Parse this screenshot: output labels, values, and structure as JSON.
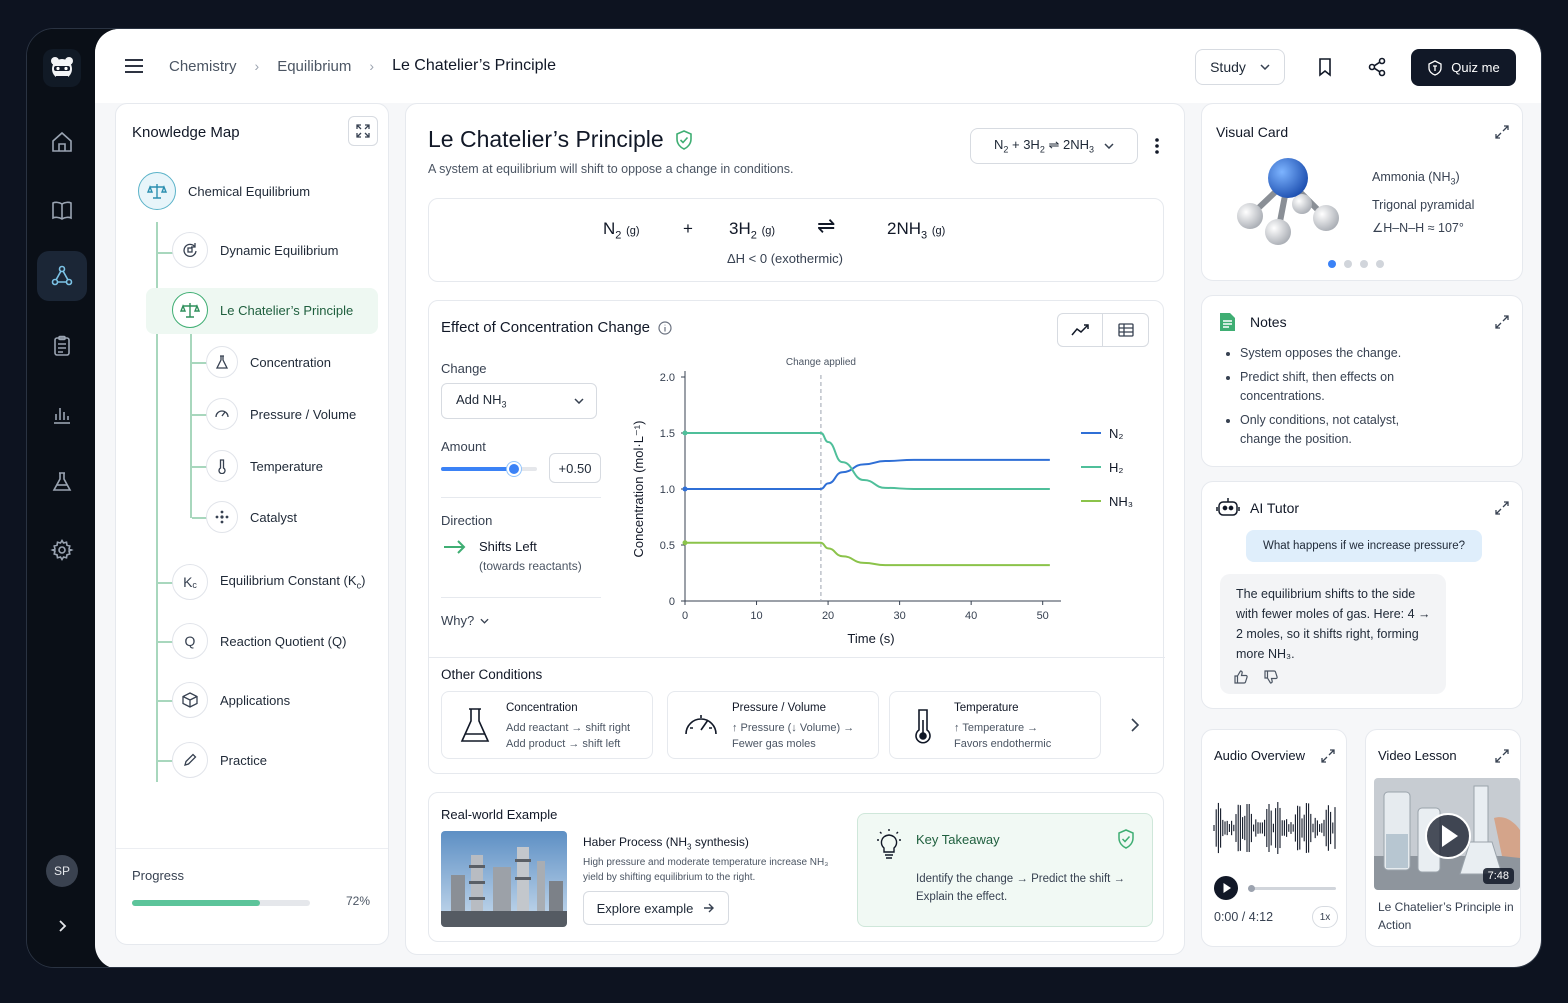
{
  "user": {
    "initials": "SP"
  },
  "breadcrumb": {
    "items": [
      "Chemistry",
      "Equilibrium"
    ],
    "current": "Le Chatelier’s Principle"
  },
  "header": {
    "study_label": "Study",
    "quiz_label": "Quiz me"
  },
  "knowledge_map": {
    "title": "Knowledge Map",
    "root": "Chemical Equilibrium",
    "nodes": {
      "dynamic": "Dynamic Equilibrium",
      "lechatelier": "Le Chatelier’s Principle",
      "concentration": "Concentration",
      "pressure": "Pressure / Volume",
      "temperature": "Temperature",
      "catalyst": "Catalyst",
      "kc": "Equilibrium Constant (K",
      "kc_sub": "c",
      "q": "Reaction Quotient (Q)",
      "applications": "Applications",
      "practice": "Practice"
    },
    "progress_label": "Progress",
    "progress_value": "72%",
    "progress_fraction": 0.72
  },
  "main": {
    "title": "Le Chatelier’s Principle",
    "subtitle": "A system at equilibrium will shift to oppose a change in conditions.",
    "equation_select": {
      "a": "N",
      "b": " + 3H",
      "c": "2NH"
    },
    "equation": {
      "n2": "N",
      "state_g": "(g)",
      "plus": "+",
      "h2": "3H",
      "arrow": "⇌",
      "nh3": "2NH",
      "dh": "ΔH < 0   (exothermic)"
    },
    "effect": {
      "title": "Effect of Concentration Change",
      "change_label": "Change",
      "change_value_prefix": "Add NH",
      "change_value_sub": "3",
      "amount_label": "Amount",
      "amount_value": "+0.50",
      "amount_fraction": 0.76,
      "direction_label": "Direction",
      "direction_value": "Shifts Left",
      "direction_sub": "(towards reactants)",
      "why_label": "Why?"
    },
    "other_conditions": {
      "title": "Other Conditions",
      "cards": [
        {
          "title": "Concentration",
          "l1": "Add reactant  →  shift right",
          "l2": "Add product  →  shift left"
        },
        {
          "title": "Pressure / Volume",
          "l1": "↑ Pressure (↓ Volume)  →",
          "l2": "Fewer gas moles"
        },
        {
          "title": "Temperature",
          "l1": "↑ Temperature  →",
          "l2": "Favors endothermic"
        }
      ]
    },
    "real_world": {
      "title": "Real-world Example",
      "heading": "Haber Process (NH",
      "heading_end": " synthesis)",
      "desc": "High pressure and moderate temperature increase NH₃ yield by shifting equilibrium to the right.",
      "button": "Explore example",
      "takeaway_title": "Key Takeaway",
      "takeaway_body": "Identify the change  →  Predict the shift  →  Explain the effect."
    }
  },
  "chart_data": {
    "type": "line",
    "title": "",
    "xlabel": "Time (s)",
    "ylabel": "Concentration (mol·L⁻¹)",
    "xlim": [
      0,
      52
    ],
    "ylim": [
      0,
      2.0
    ],
    "xticks": [
      0,
      10,
      20,
      30,
      40,
      50
    ],
    "yticks": [
      0,
      0.5,
      1.0,
      1.5,
      2.0
    ],
    "ytick_labels": [
      "0",
      "0.5",
      "1.0",
      "1.5",
      "2.0"
    ],
    "annotation": {
      "x": 19,
      "text": "Change applied"
    },
    "legend_position": "right",
    "series": [
      {
        "name": "N₂",
        "color": "#2f6fd6",
        "x": [
          0,
          19,
          20,
          22,
          25,
          28,
          32,
          40,
          51
        ],
        "y": [
          1.0,
          1.0,
          1.05,
          1.15,
          1.22,
          1.25,
          1.26,
          1.26,
          1.26
        ]
      },
      {
        "name": "H₂",
        "color": "#4fbf9a",
        "x": [
          0,
          19,
          20,
          22,
          25,
          28,
          32,
          40,
          51
        ],
        "y": [
          1.5,
          1.5,
          1.42,
          1.24,
          1.08,
          1.01,
          1.0,
          1.0,
          1.0
        ]
      },
      {
        "name": "NH₃",
        "color": "#8bc34a",
        "x": [
          0,
          19,
          20,
          22,
          25,
          28,
          32,
          40,
          51
        ],
        "y": [
          0.52,
          0.52,
          0.47,
          0.4,
          0.34,
          0.32,
          0.32,
          0.32,
          0.32
        ]
      }
    ]
  },
  "right": {
    "visual_card": {
      "title": "Visual Card",
      "l1": "Ammonia (NH",
      "l1_end": ")",
      "l2": "Trigonal pyramidal",
      "l3": "∠H–N–H ≈ 107°"
    },
    "notes": {
      "title": "Notes",
      "items": [
        "System opposes the change.",
        "Predict shift, then effects on concentrations.",
        "Only conditions, not catalyst, change the position."
      ]
    },
    "tutor": {
      "title": "AI Tutor",
      "question": "What happens if we increase pressure?",
      "answer": "The equilibrium shifts to the side with fewer moles of gas. Here: 4 → 2 moles, so it shifts right, forming more NH₃."
    },
    "audio": {
      "title": "Audio Overview",
      "time": "0:00 / 4:12",
      "speed": "1x"
    },
    "video": {
      "title": "Video Lesson",
      "duration": "7:48",
      "caption": "Le Chatelier’s Principle in Action"
    }
  }
}
